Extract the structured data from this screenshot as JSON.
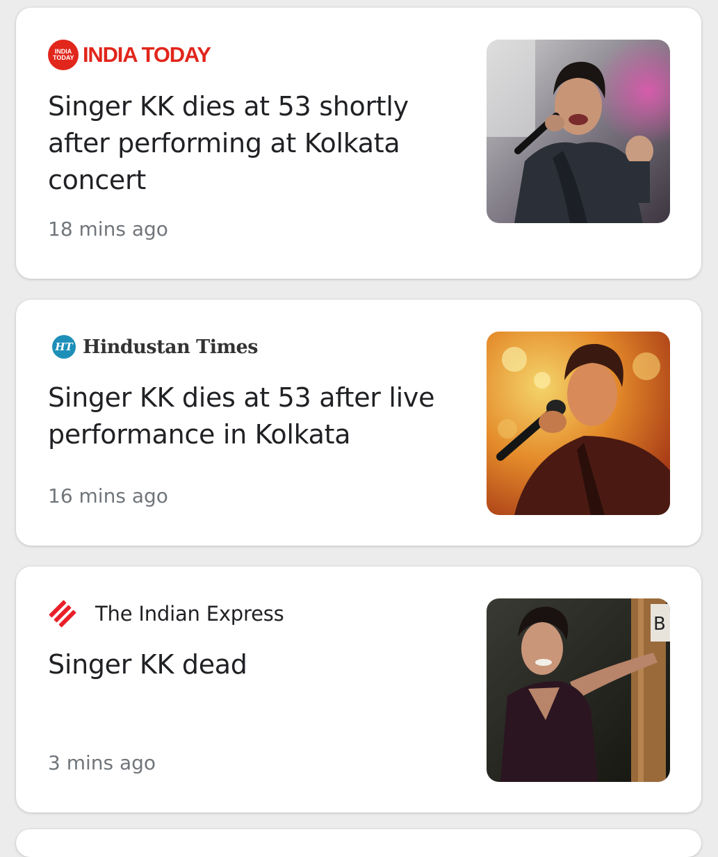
{
  "articles": [
    {
      "source": {
        "name": "INDIA TODAY",
        "logo_text": "INDIA TODAY",
        "logo_icon": "india-today-logo-icon",
        "color": "#e1261c"
      },
      "headline": "Singer KK dies at 53 shortly after performing at Kolkata concert",
      "time": "18 mins ago",
      "thumbnail_icon": "singer-performing-image"
    },
    {
      "source": {
        "name": "Hindustan Times",
        "logo_text": "HT",
        "logo_icon": "hindustan-times-logo-icon",
        "color": "#1e8fb8"
      },
      "headline": "Singer KK dies at 53 after live performance in Kolkata",
      "time": "16 mins ago",
      "thumbnail_icon": "singer-with-microphone-image"
    },
    {
      "source": {
        "name": "The Indian Express",
        "logo_icon": "indian-express-logo-icon",
        "color": "#e8202a"
      },
      "headline": "Singer KK dead",
      "time": "3 mins ago",
      "thumbnail_icon": "singer-leaning-on-post-image"
    }
  ]
}
